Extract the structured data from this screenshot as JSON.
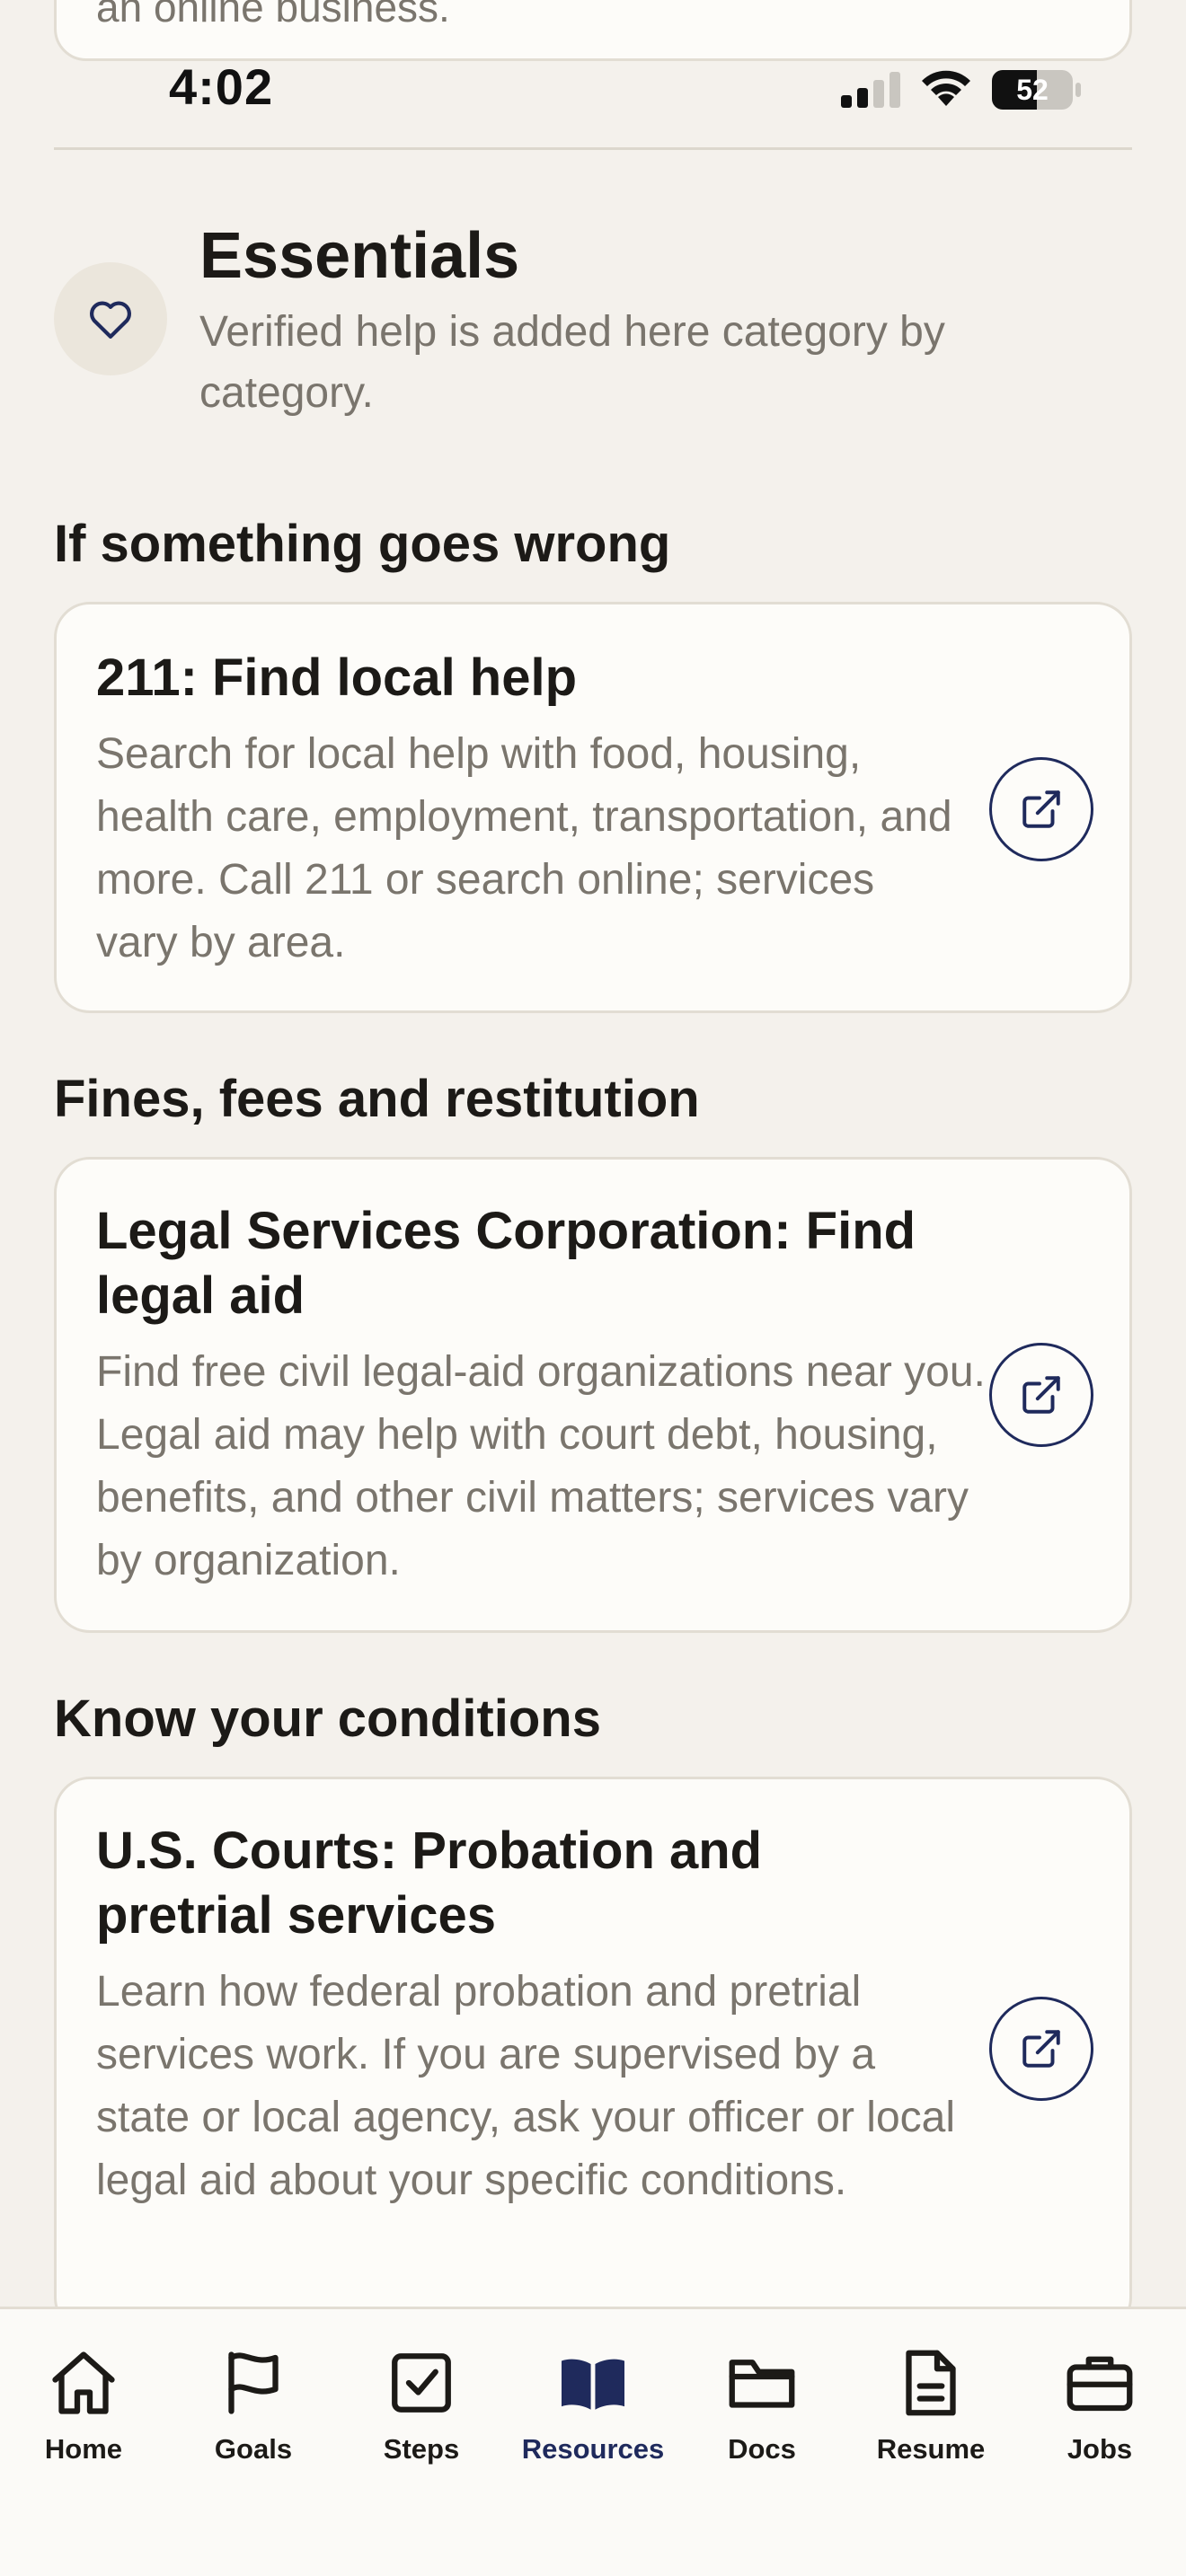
{
  "partial_card": {
    "text": "an online business."
  },
  "status_bar": {
    "time": "4:02",
    "battery": "52"
  },
  "essentials": {
    "title": "Essentials",
    "subtitle": "Verified help is added here category by category.",
    "icon": "heart-icon"
  },
  "sections": [
    {
      "heading": "If something goes wrong",
      "card": {
        "title": "211: Find local help",
        "description": "Search for local help with food, housing, health care, employment, transportation, and more. Call 211 or search online; services vary by area."
      }
    },
    {
      "heading": "Fines, fees and restitution",
      "card": {
        "title": "Legal Services Corporation: Find legal aid",
        "description": "Find free civil legal-aid organizations near you. Legal aid may help with court debt, housing, benefits, and other civil matters; services vary by organization."
      }
    },
    {
      "heading": "Know your conditions",
      "card": {
        "title": "U.S. Courts: Probation and pretrial services",
        "description": "Learn how federal probation and pretrial services work. If you are supervised by a state or local agency, ask your officer or local legal aid about your specific conditions."
      }
    }
  ],
  "nav": {
    "active": "Resources",
    "active_color": "#1f2a5c",
    "items": [
      {
        "label": "Home",
        "icon": "home-icon"
      },
      {
        "label": "Goals",
        "icon": "flag-icon"
      },
      {
        "label": "Steps",
        "icon": "checkbox-icon"
      },
      {
        "label": "Resources",
        "icon": "book-icon"
      },
      {
        "label": "Docs",
        "icon": "folder-icon"
      },
      {
        "label": "Resume",
        "icon": "document-icon"
      },
      {
        "label": "Jobs",
        "icon": "briefcase-icon"
      }
    ]
  }
}
